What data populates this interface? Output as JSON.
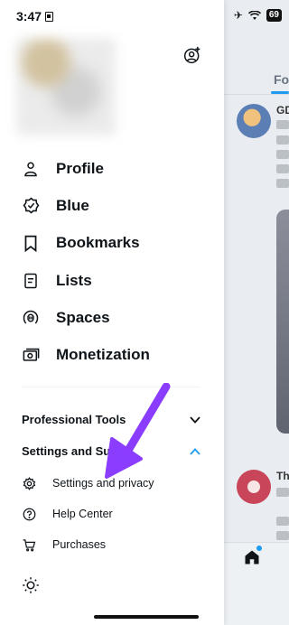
{
  "status_bar": {
    "time": "3:47",
    "battery": "69"
  },
  "timeline_background": {
    "tab_label": "Fo",
    "post1_name": "GD",
    "post2_name": "Th"
  },
  "drawer": {
    "menu": [
      {
        "id": "profile",
        "label": "Profile",
        "icon": "person-icon"
      },
      {
        "id": "blue",
        "label": "Blue",
        "icon": "verified-badge-icon"
      },
      {
        "id": "bookmarks",
        "label": "Bookmarks",
        "icon": "bookmark-icon"
      },
      {
        "id": "lists",
        "label": "Lists",
        "icon": "list-icon"
      },
      {
        "id": "spaces",
        "label": "Spaces",
        "icon": "microphone-icon"
      },
      {
        "id": "monetization",
        "label": "Monetization",
        "icon": "money-icon"
      }
    ],
    "professional_tools": {
      "label": "Professional Tools",
      "expanded": false
    },
    "settings_support": {
      "label": "Settings and Supp",
      "expanded": true,
      "items": [
        {
          "id": "settings",
          "label": "Settings and privacy",
          "icon": "gear-icon"
        },
        {
          "id": "help",
          "label": "Help Center",
          "icon": "question-circle-icon"
        },
        {
          "id": "purchases",
          "label": "Purchases",
          "icon": "cart-icon"
        }
      ]
    }
  },
  "colors": {
    "accent": "#1d9bf0",
    "arrow": "#8b3dff",
    "text": "#0f1419"
  }
}
